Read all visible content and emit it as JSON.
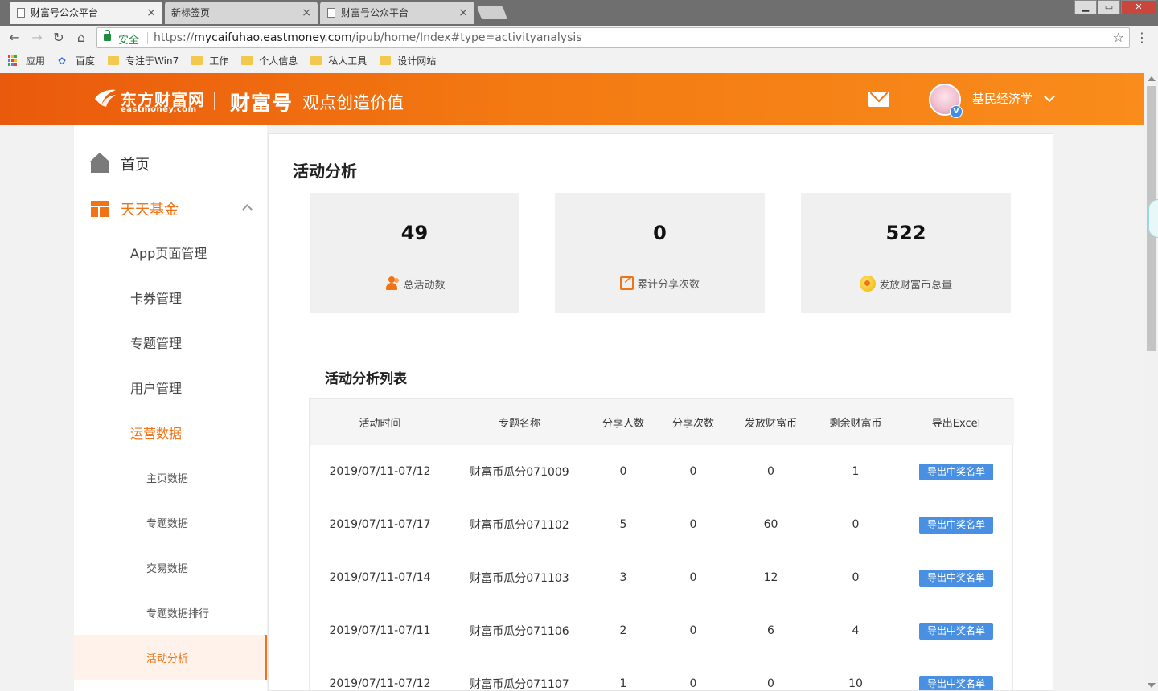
{
  "browser": {
    "tabs": [
      {
        "title": "财富号公众平台",
        "active": true
      },
      {
        "title": "新标签页",
        "active": false
      },
      {
        "title": "财富号公众平台",
        "active": false
      }
    ],
    "tab_close": "×",
    "secure_label": "安全",
    "url_scheme": "https://",
    "url_host": "mycaifuhao.eastmoney.com",
    "url_path": "/ipub/home/Index#type=activityanalysis",
    "window_buttons": [
      "▁",
      "▭",
      "✕"
    ],
    "bookmarks": [
      {
        "label": "应用",
        "icon": "apps-icon"
      },
      {
        "label": "百度",
        "icon": "baidu-icon"
      },
      {
        "label": "专注于Win7",
        "icon": "folder-icon"
      },
      {
        "label": "工作",
        "icon": "folder-icon"
      },
      {
        "label": "个人信息",
        "icon": "folder-icon"
      },
      {
        "label": "私人工具",
        "icon": "folder-icon"
      },
      {
        "label": "设计网站",
        "icon": "folder-icon"
      }
    ]
  },
  "header": {
    "logo_cn": "东方财富网",
    "logo_en": "eastmoney.com",
    "brand": "财富号",
    "slogan": "观点创造价值",
    "user_name": "基民经济学",
    "verified_badge": "V",
    "accent": "#f07416"
  },
  "sidebar": {
    "home": "首页",
    "fund": "天天基金",
    "items": [
      "App页面管理",
      "卡券管理",
      "专题管理",
      "用户管理",
      "运营数据"
    ],
    "sub_items": [
      "主页数据",
      "专题数据",
      "交易数据",
      "专题数据排行",
      "活动分析"
    ]
  },
  "main": {
    "title": "活动分析",
    "stats": [
      {
        "value": "49",
        "label": "总活动数",
        "icon": "people-icon"
      },
      {
        "value": "0",
        "label": "累计分享次数",
        "icon": "share-icon"
      },
      {
        "value": "522",
        "label": "发放财富币总量",
        "icon": "coin-icon"
      }
    ],
    "list_title": "活动分析列表",
    "columns": [
      "活动时间",
      "专题名称",
      "分享人数",
      "分享次数",
      "发放财富币",
      "剩余财富币",
      "导出Excel"
    ],
    "export_label": "导出中奖名单",
    "rows": [
      {
        "time": "2019/07/11-07/12",
        "name": "财富币瓜分071009",
        "sharers": "0",
        "shares": "0",
        "issued": "0",
        "remaining": "1"
      },
      {
        "time": "2019/07/11-07/17",
        "name": "财富币瓜分071102",
        "sharers": "5",
        "shares": "0",
        "issued": "60",
        "remaining": "0"
      },
      {
        "time": "2019/07/11-07/14",
        "name": "财富币瓜分071103",
        "sharers": "3",
        "shares": "0",
        "issued": "12",
        "remaining": "0"
      },
      {
        "time": "2019/07/11-07/11",
        "name": "财富币瓜分071106",
        "sharers": "2",
        "shares": "0",
        "issued": "6",
        "remaining": "4"
      },
      {
        "time": "2019/07/11-07/12",
        "name": "财富币瓜分071107",
        "sharers": "1",
        "shares": "0",
        "issued": "0",
        "remaining": "10"
      }
    ]
  }
}
